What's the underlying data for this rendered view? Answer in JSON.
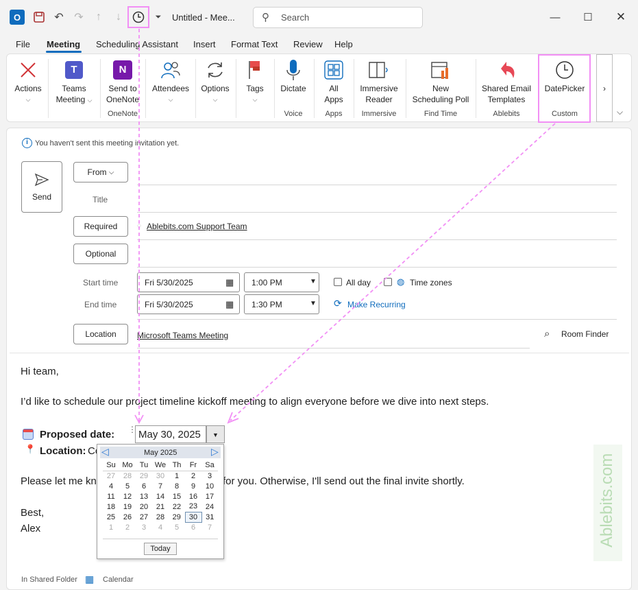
{
  "titlebar": {
    "window_title": "Untitled  -  Mee...",
    "search_placeholder": "Search"
  },
  "menu": [
    "File",
    "Meeting",
    "Scheduling Assistant",
    "Insert",
    "Format Text",
    "Review",
    "Help"
  ],
  "ribbon": {
    "actions": "Actions",
    "teams": [
      "Teams",
      "Meeting"
    ],
    "onenote": [
      "Send to",
      "OneNote"
    ],
    "onenote_group": "OneNote",
    "attendees": "Attendees",
    "options": "Options",
    "tags": "Tags",
    "dictate": "Dictate",
    "voice_group": "Voice",
    "allapps": [
      "All",
      "Apps"
    ],
    "apps_group": "Apps",
    "immersive": [
      "Immersive",
      "Reader"
    ],
    "immersive_group": "Immersive",
    "poll": [
      "New",
      "Scheduling Poll"
    ],
    "findtime_group": "Find Time",
    "shared": [
      "Shared Email",
      "Templates"
    ],
    "ablebits_group": "Ablebits",
    "datepicker": "DatePicker",
    "custom_group": "Custom"
  },
  "form": {
    "info": "You haven't sent this meeting invitation yet.",
    "send": "Send",
    "from": "From",
    "title": "Title",
    "required": "Required",
    "required_value": "Ablebits.com Support Team",
    "optional": "Optional",
    "start_label": "Start time",
    "start_date": "Fri 5/30/2025",
    "start_time": "1:00 PM",
    "end_label": "End time",
    "end_date": "Fri 5/30/2025",
    "end_time": "1:30 PM",
    "all_day": "All day",
    "time_zones": "Time zones",
    "recurring": "Make Recurring",
    "location": "Location",
    "location_value": "Microsoft Teams Meeting",
    "room_finder": "Room Finder"
  },
  "body": {
    "greeting": "Hi team,",
    "line1": "I’d like to schedule our project timeline kickoff meeting to align everyone before we dive into next steps.",
    "proposed_label": "Proposed date:",
    "proposed_value": "May 30, 2025",
    "location_label": "Location:",
    "location_value": "Co",
    "line2_start": "Please let me kn",
    "line2_end": "ork for you. Otherwise, I'll send out the final invite shortly.",
    "best": "Best,",
    "name": "Alex"
  },
  "calendar": {
    "month": "May 2025",
    "days": [
      "Su",
      "Mo",
      "Tu",
      "We",
      "Th",
      "Fr",
      "Sa"
    ],
    "weeks": [
      [
        "27",
        "28",
        "29",
        "30",
        "1",
        "2",
        "3"
      ],
      [
        "4",
        "5",
        "6",
        "7",
        "8",
        "9",
        "10"
      ],
      [
        "11",
        "12",
        "13",
        "14",
        "15",
        "16",
        "17"
      ],
      [
        "18",
        "19",
        "20",
        "21",
        "22",
        "23",
        "24"
      ],
      [
        "25",
        "26",
        "27",
        "28",
        "29",
        "30",
        "31"
      ],
      [
        "1",
        "2",
        "3",
        "4",
        "5",
        "6",
        "7"
      ]
    ],
    "today": "Today"
  },
  "footer": {
    "folder": "In Shared Folder",
    "calendar": "Calendar"
  },
  "watermark": "Ablebits.com"
}
